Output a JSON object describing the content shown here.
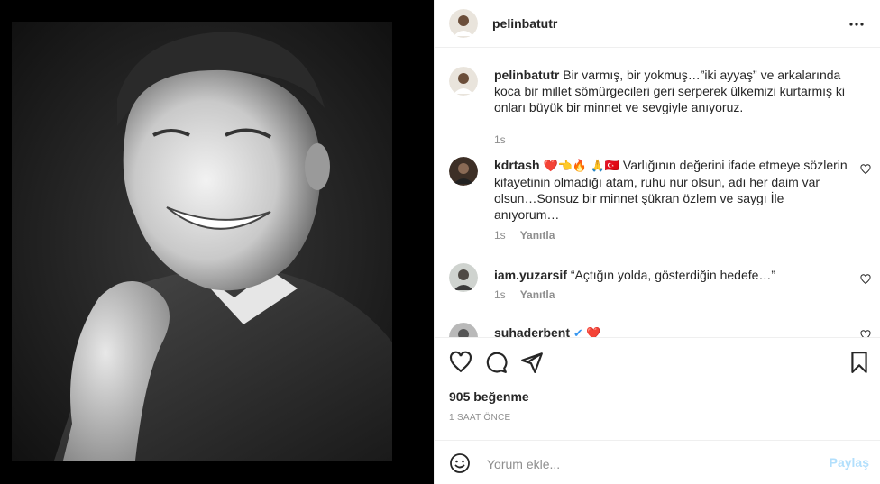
{
  "post": {
    "author": "pelinbatutr",
    "more_icon": "more-horizontal-icon",
    "caption": {
      "username": "pelinbatutr",
      "text": "Bir varmış, bir yokmuş…”iki ayyaş” ve arkalarında koca bir millet sömürgecileri geri serperek ülkemizi kurtarmış ki onları büyük bir minnet ve sevgiyle anıyoruz.",
      "time": "1s"
    },
    "comments": [
      {
        "username": "kdrtash",
        "emojis": "❤️👈🔥 🙏🇹🇷",
        "text": "Varlığının değerini ifade etmeye sözlerin kifayetinin olmadığı atam, ruhu nur olsun, adı her daim var olsun…Sonsuz bir minnet şükran özlem ve saygı İle anıyorum…",
        "time": "1s",
        "reply_label": "Yanıtla"
      },
      {
        "username": "iam.yuzarsif",
        "emojis": "",
        "text": "“Açtığın yolda, gösterdiğin hedefe…”",
        "time": "1s",
        "reply_label": "Yanıtla"
      },
      {
        "username": "suhaderbent",
        "emojis": "✔ ❤️",
        "text": "",
        "time": "",
        "reply_label": ""
      }
    ],
    "likes": "905 beğenme",
    "time_ago": "1 SAAT ÖNCE",
    "add_comment": {
      "placeholder": "Yorum ekle...",
      "post_label": "Paylaş"
    },
    "icons": [
      "heart-icon",
      "comment-icon",
      "share-icon",
      "bookmark-icon",
      "emoji-icon"
    ],
    "colors": {
      "accent_disabled": "#b2dffc",
      "muted": "#8e8e8e",
      "text": "#262626",
      "border": "#efefef"
    }
  }
}
